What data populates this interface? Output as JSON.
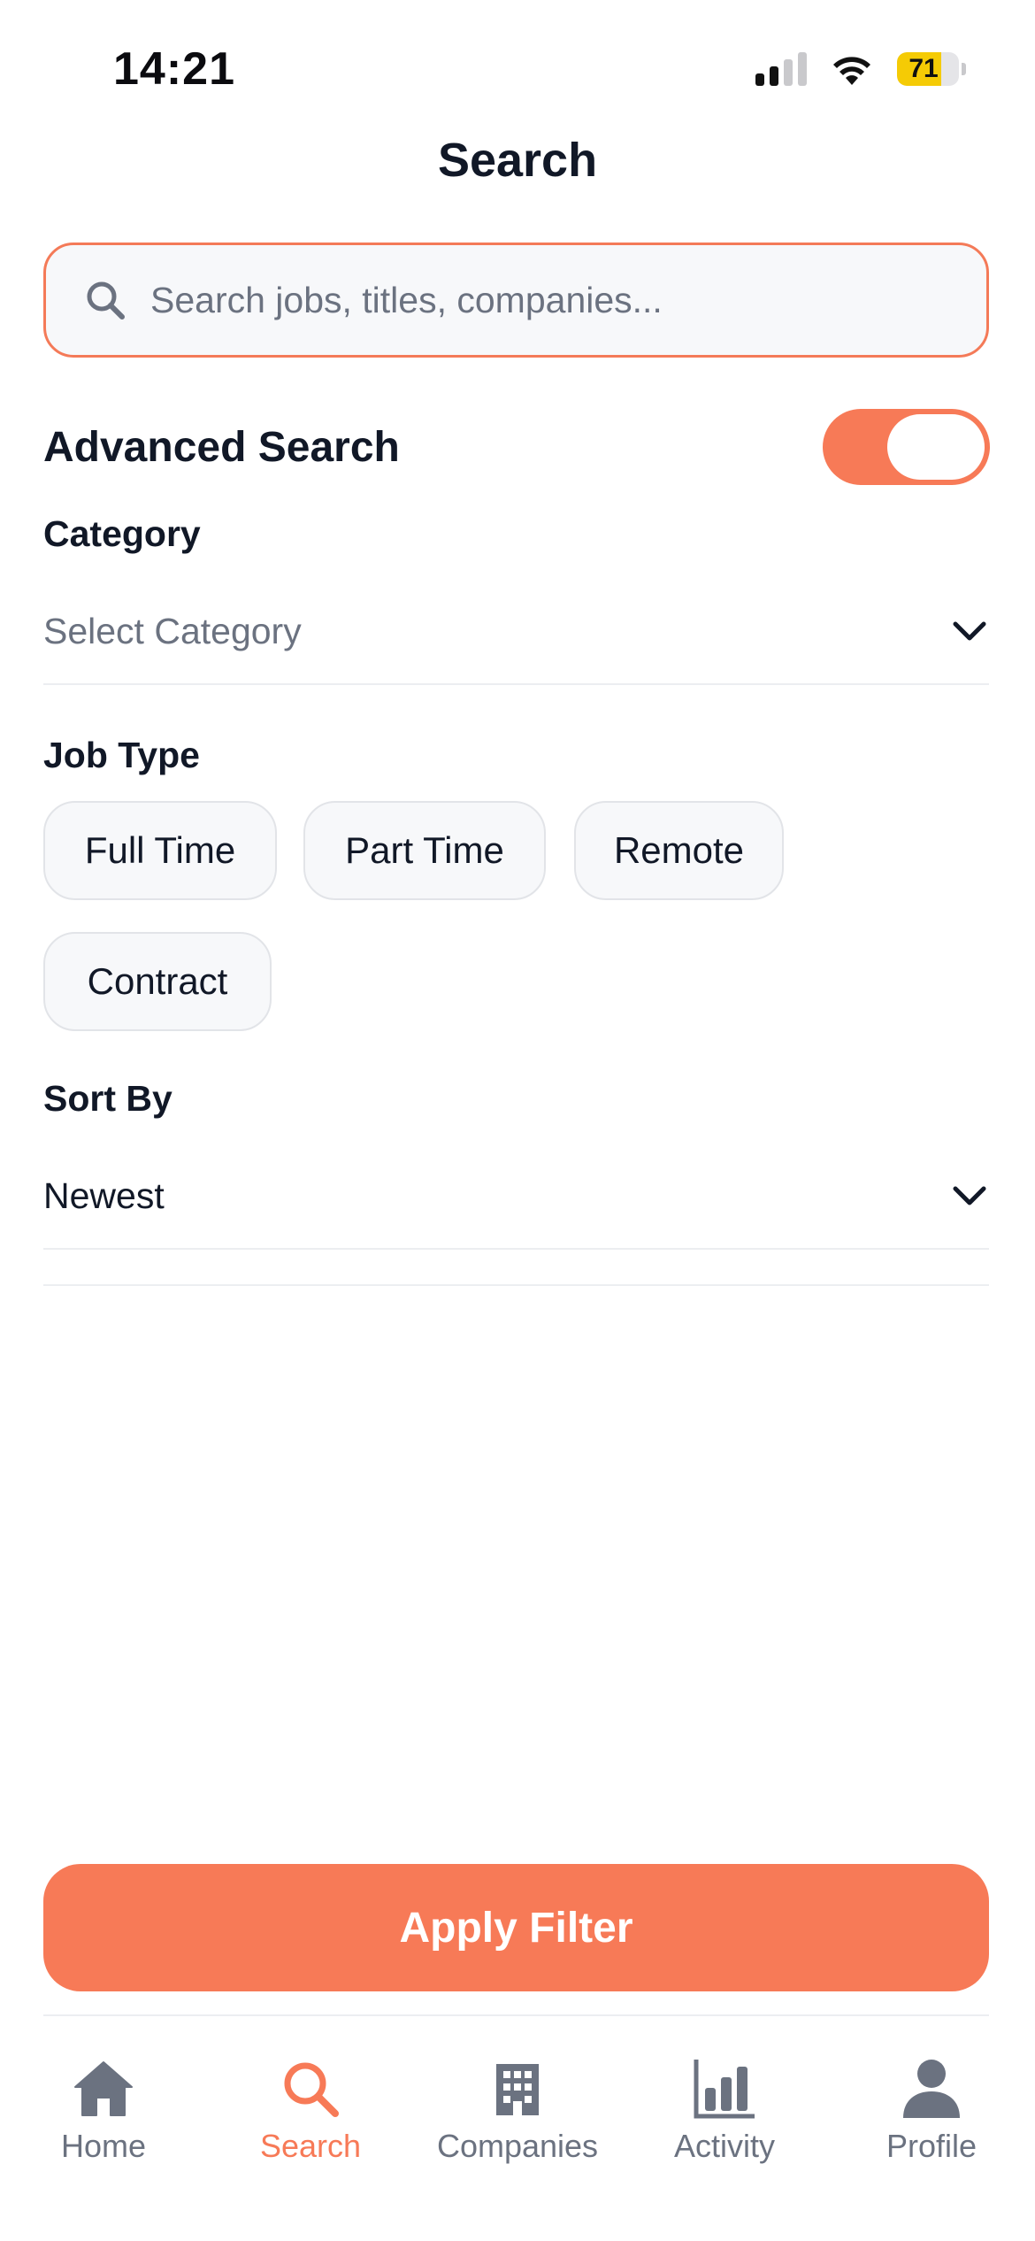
{
  "status_bar": {
    "time": "14:21",
    "battery_level": "71",
    "battery_fraction": 0.71,
    "signal_bars_active": 2,
    "signal_bars_total": 4,
    "icons": [
      "signal-icon",
      "wifi-icon",
      "battery-icon"
    ]
  },
  "header": {
    "title": "Search"
  },
  "search": {
    "placeholder": "Search jobs, titles, companies...",
    "value": "",
    "icon": "search-icon"
  },
  "advanced_search": {
    "label": "Advanced Search",
    "enabled": true
  },
  "category": {
    "label": "Category",
    "placeholder": "Select Category",
    "value": ""
  },
  "job_type": {
    "label": "Job Type",
    "options": [
      "Full Time",
      "Part Time",
      "Remote",
      "Contract"
    ]
  },
  "sort_by": {
    "label": "Sort By",
    "value": "Newest"
  },
  "apply_button": {
    "label": "Apply Filter"
  },
  "tab_bar": {
    "items": [
      {
        "label": "Home",
        "icon": "home-icon",
        "active": false
      },
      {
        "label": "Search",
        "icon": "search-icon",
        "active": true
      },
      {
        "label": "Companies",
        "icon": "building-icon",
        "active": false
      },
      {
        "label": "Activity",
        "icon": "bar-chart-icon",
        "active": false
      },
      {
        "label": "Profile",
        "icon": "person-icon",
        "active": false
      }
    ]
  },
  "colors": {
    "accent": "#F77A57",
    "text_primary": "#111827",
    "text_secondary": "#6B7280",
    "battery_yellow": "#F5CB05"
  }
}
